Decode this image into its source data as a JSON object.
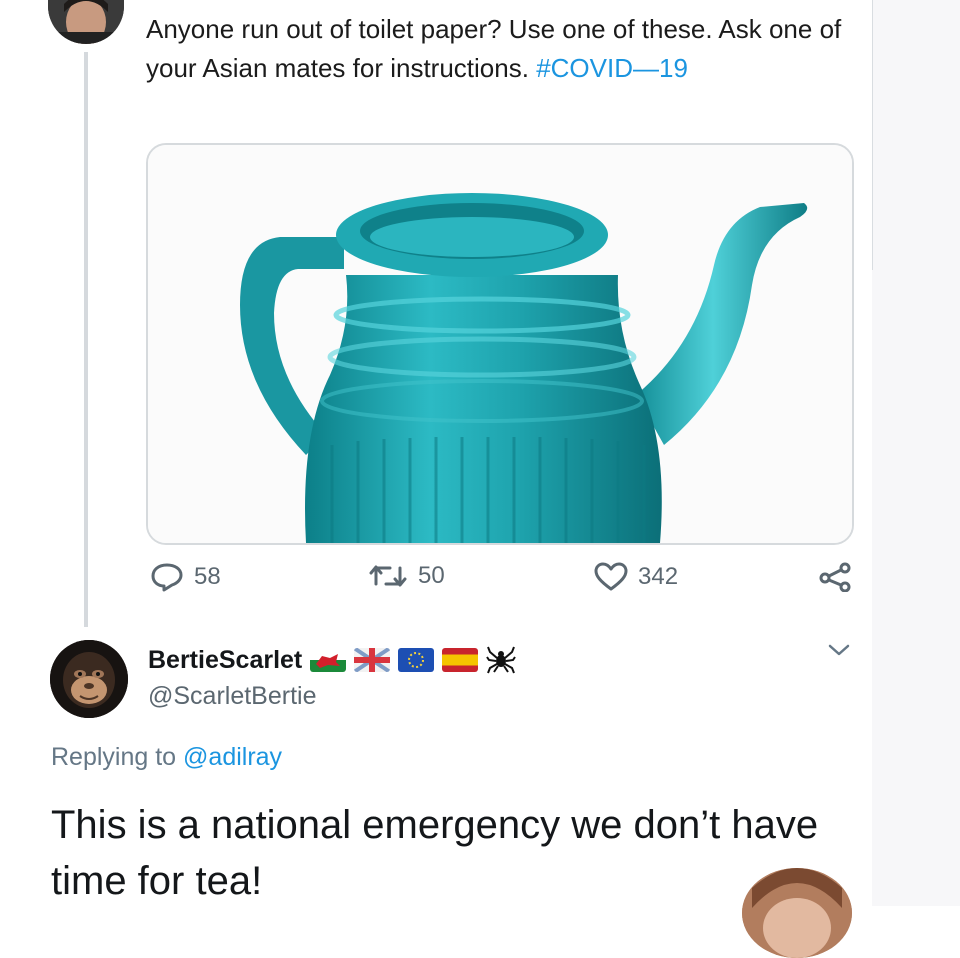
{
  "tweet": {
    "text": "Anyone run out of toilet paper? Use one of these. Ask one of your Asian mates for instructions.",
    "hashtag": "#COVID—19",
    "media_description_icon": "teal-spouted-pot",
    "actions": {
      "replies": "58",
      "retweets": "50",
      "likes": "342"
    }
  },
  "reply": {
    "display_name": "BertieScarlet",
    "name_emojis": [
      "wales-flag",
      "uk-flag",
      "eu-flag",
      "spain-flag",
      "spider"
    ],
    "handle": "@ScarletBertie",
    "replying_prefix": "Replying to",
    "replying_to": "@adilray",
    "text": "This is a national emergency we don’t have time for tea!"
  },
  "colors": {
    "link": "#1b95e0",
    "secondary_text": "#657786",
    "pot_teal": "#1fa5b0"
  }
}
